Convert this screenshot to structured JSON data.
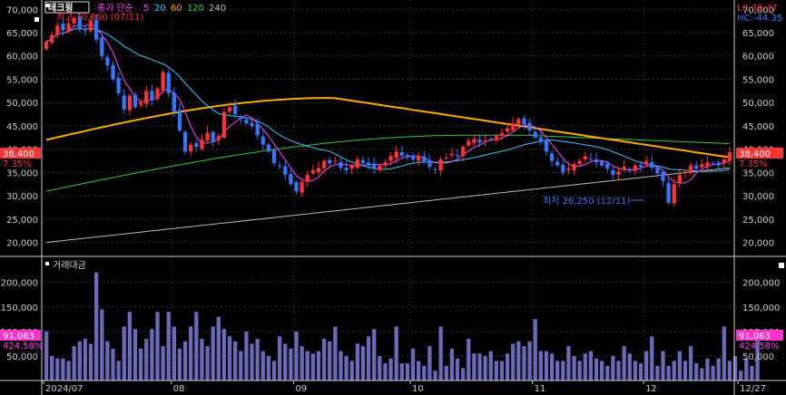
{
  "title": "테크윙",
  "indicator": {
    "label": "종가 단순",
    "periods": [
      "5",
      "20",
      "60",
      "120",
      "240"
    ],
    "colors": [
      "#ff44ff",
      "#33ccff",
      "#ffaa00",
      "#33cc33",
      "#bbbbbb"
    ]
  },
  "volume_label": "거래대금",
  "right_badges": {
    "lc": "LC:39.47",
    "hc": "HC:-44.35",
    "price_tag": "38,400",
    "pct_tag": "7.35%",
    "vol_tag": "91,063",
    "vol_pct_tag": "424.58%"
  },
  "annotations": {
    "high": "최고 70,800 (07/11)",
    "low": "최저 28,250 (12/11)"
  },
  "colors": {
    "up": "#ff3333",
    "down": "#3377ff",
    "volume_bar": "#6a6ab8",
    "ma5": "#ff44ff",
    "ma20": "#33ccff",
    "ma60": "#ffaa00",
    "ma120": "#33cc33",
    "ma240": "#bbbbbb"
  },
  "chart_data": [
    {
      "type": "candlestick",
      "title": "테크윙",
      "y_ticks": [
        "70,000",
        "65,000",
        "60,000",
        "55,000",
        "50,000",
        "45,000",
        "40,000",
        "35,000",
        "30,000",
        "25,000",
        "20,000"
      ],
      "y_tick_values": [
        70000,
        65000,
        60000,
        55000,
        50000,
        45000,
        40000,
        35000,
        30000,
        25000,
        20000
      ],
      "ylim": [
        17000,
        72000
      ],
      "x_labels": [
        "2024/07",
        "08",
        "09",
        "10",
        "11",
        "12",
        "12/27"
      ],
      "x_label_index": [
        0,
        23,
        45,
        66,
        88,
        108,
        125
      ],
      "series_close": [
        63000,
        64500,
        66500,
        65500,
        67000,
        68200,
        66000,
        65500,
        67500,
        63500,
        60000,
        58000,
        55000,
        52000,
        48500,
        51500,
        49000,
        50000,
        52500,
        50500,
        53000,
        56500,
        52000,
        48000,
        44000,
        39500,
        41000,
        40500,
        42000,
        43500,
        41500,
        42800,
        48000,
        49000,
        47500,
        46500,
        45500,
        45000,
        43000,
        41000,
        39500,
        37000,
        36500,
        34500,
        32500,
        31000,
        33000,
        34500,
        35500,
        36000,
        37500,
        37000,
        37500,
        36000,
        35500,
        36500,
        37800,
        37000,
        36500,
        35800,
        36500,
        37200,
        38500,
        39500,
        38600,
        38200,
        37800,
        38500,
        37200,
        36200,
        35600,
        37800,
        38200,
        39000,
        38500,
        40500,
        41800,
        42200,
        41500,
        41800,
        42200,
        42800,
        43500,
        44500,
        45500,
        46500,
        45200,
        44000,
        42500,
        41500,
        39500,
        37500,
        36500,
        35000,
        35800,
        36800,
        37500,
        38500,
        38000,
        37200,
        36500,
        35800,
        34500,
        35200,
        36200,
        35500,
        36500,
        36200,
        37500,
        36000,
        34800,
        33200,
        28500,
        32500,
        34500,
        35200,
        36500,
        35800,
        36800,
        37200,
        37000,
        36500,
        37800,
        39400
      ],
      "series_volume": [
        100,
        50,
        45,
        45,
        40,
        70,
        80,
        85,
        75,
        220,
        145,
        80,
        65,
        40,
        110,
        140,
        105,
        65,
        85,
        105,
        140,
        70,
        140,
        110,
        65,
        80,
        110,
        140,
        85,
        70,
        110,
        130,
        105,
        90,
        80,
        60,
        100,
        75,
        85,
        60,
        50,
        40,
        90,
        75,
        65,
        100,
        70,
        60,
        55,
        60,
        85,
        80,
        110,
        60,
        50,
        40,
        75,
        70,
        90,
        105,
        50,
        35,
        45,
        110,
        35,
        35,
        65,
        40,
        30,
        70,
        20,
        110,
        30,
        65,
        45,
        25,
        85,
        55,
        55,
        50,
        60,
        40,
        40,
        55,
        75,
        80,
        70,
        80,
        125,
        60,
        60,
        55,
        40,
        40,
        70,
        50,
        40,
        55,
        60,
        45,
        40,
        30,
        50,
        40,
        70,
        55,
        40,
        35,
        60,
        90,
        30,
        60,
        30,
        40,
        60,
        40,
        70,
        35,
        25,
        45,
        30,
        45,
        110,
        40,
        50,
        20,
        45,
        30,
        105
      ]
    }
  ]
}
